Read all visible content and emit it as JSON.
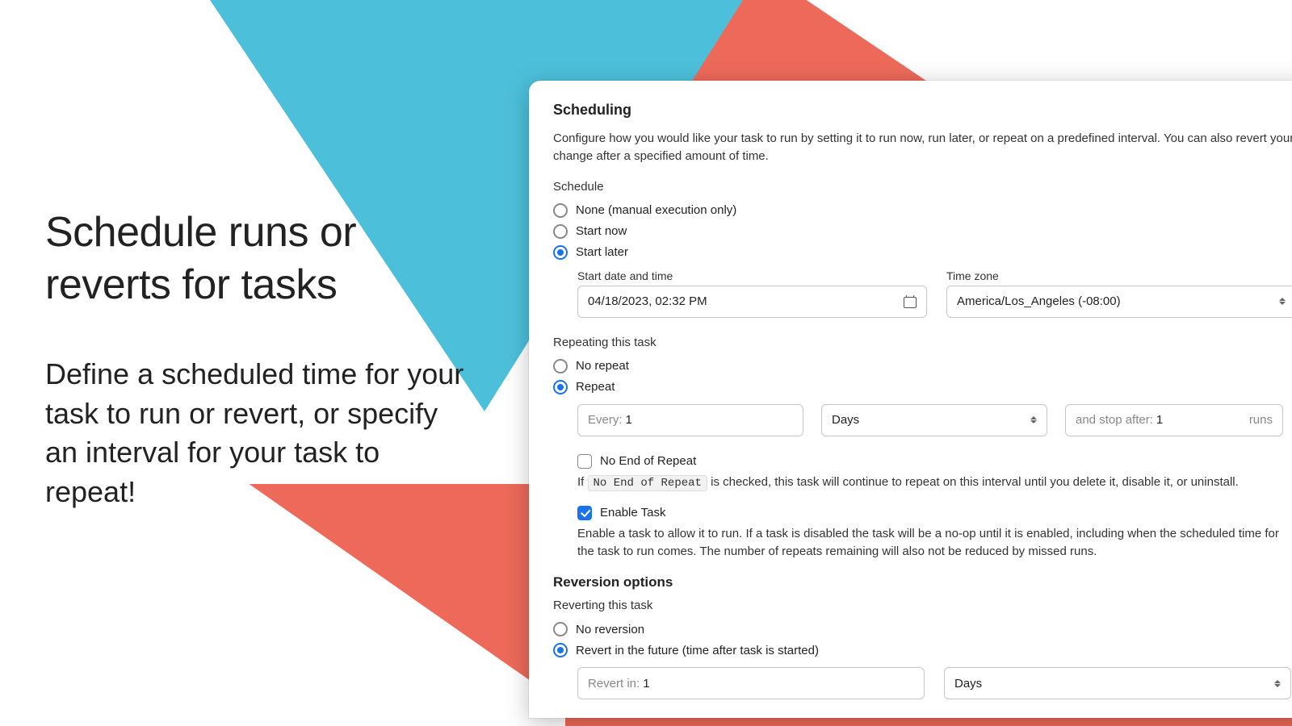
{
  "marketing": {
    "headline": "Schedule runs or reverts for tasks",
    "body": "Define a scheduled time for your task to run or revert, or specify an interval for your task to repeat!"
  },
  "panel": {
    "title": "Scheduling",
    "description": "Configure how you would like your task to run by setting it to run now, run later, or repeat on a predefined interval. You can also revert your change after a specified amount of time.",
    "schedule": {
      "label": "Schedule",
      "options": {
        "none": "None (manual execution only)",
        "now": "Start now",
        "later": "Start later"
      },
      "selected": "later",
      "start_datetime": {
        "label": "Start date and time",
        "value": "04/18/2023, 02:32 PM"
      },
      "timezone": {
        "label": "Time zone",
        "value": "America/Los_Angeles (-08:00)"
      }
    },
    "repeat": {
      "label": "Repeating this task",
      "options": {
        "none": "No repeat",
        "repeat": "Repeat"
      },
      "selected": "repeat",
      "every_prefix": "Every:",
      "every_value": "1",
      "unit": "Days",
      "stop_prefix": "and stop after:",
      "stop_value": "1",
      "stop_suffix": "runs",
      "no_end": {
        "label": "No End of Repeat",
        "checked": false
      },
      "no_end_help_prefix": "If ",
      "no_end_help_code": "No End of Repeat",
      "no_end_help_suffix": " is checked, this task will continue to repeat on this interval until you delete it, disable it, or uninstall.",
      "enable": {
        "label": "Enable Task",
        "checked": true
      },
      "enable_help": "Enable a task to allow it to run. If a task is disabled the task will be a no-op until it is enabled, including when the scheduled time for the task to run comes. The number of repeats remaining will also not be reduced by missed runs."
    },
    "reversion": {
      "title": "Reversion options",
      "label": "Reverting this task",
      "options": {
        "none": "No reversion",
        "future": "Revert in the future (time after task is started)"
      },
      "selected": "future",
      "revert_prefix": "Revert in:",
      "revert_value": "1",
      "revert_unit": "Days"
    }
  }
}
